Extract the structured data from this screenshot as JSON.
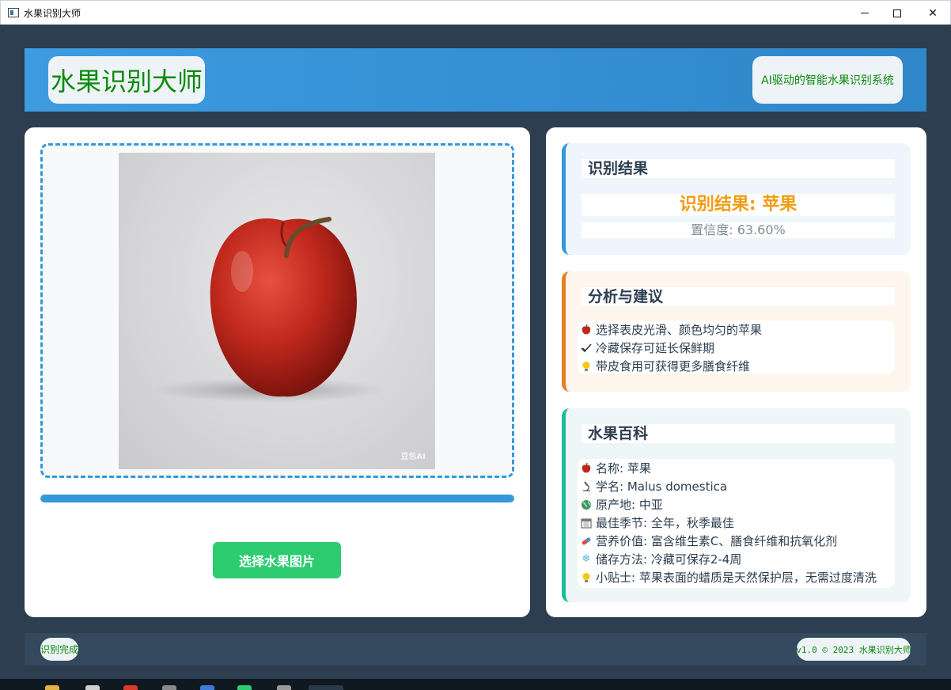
{
  "window": {
    "title": "水果识别大师"
  },
  "header": {
    "brand": "水果识别大师",
    "tagline": "AI驱动的智能水果识别系统"
  },
  "left": {
    "watermark": "豆包AI",
    "progress": 1.0,
    "select_button": "选择水果图片"
  },
  "result": {
    "title": "识别结果",
    "main": "识别结果: 苹果",
    "confidence": "置信度: 63.60%"
  },
  "advice": {
    "title": "分析与建议",
    "items": [
      {
        "icon": "apple-icon",
        "text": "选择表皮光滑、颜色均匀的苹果"
      },
      {
        "icon": "checkmark-icon",
        "text": "冷藏保存可延长保鲜期"
      },
      {
        "icon": "lightbulb-icon",
        "text": "带皮食用可获得更多膳食纤维"
      }
    ]
  },
  "wiki": {
    "title": "水果百科",
    "items": [
      {
        "icon": "apple-icon",
        "text": "名称: 苹果"
      },
      {
        "icon": "microscope-icon",
        "text": "学名: Malus domestica"
      },
      {
        "icon": "globe-icon",
        "text": "原产地: 中亚"
      },
      {
        "icon": "calendar-icon",
        "text": "最佳季节: 全年，秋季最佳"
      },
      {
        "icon": "pill-icon",
        "text": "营养价值: 富含维生素C、膳食纤维和抗氧化剂"
      },
      {
        "icon": "snowflake-icon",
        "text": "储存方法: 冷藏可保存2-4周"
      },
      {
        "icon": "lightbulb-icon",
        "text": "小贴士: 苹果表面的蜡质是天然保护层，无需过度清洗"
      }
    ]
  },
  "footer": {
    "status": "识别完成",
    "version": "v1.0 © 2023 水果识别大师"
  },
  "colors": {
    "accent": "#3498db",
    "button": "#2ecc71",
    "result": "#f39c12",
    "advice": "#e67e22",
    "wiki": "#1abc9c",
    "brand_text": "#0a8a0a"
  }
}
